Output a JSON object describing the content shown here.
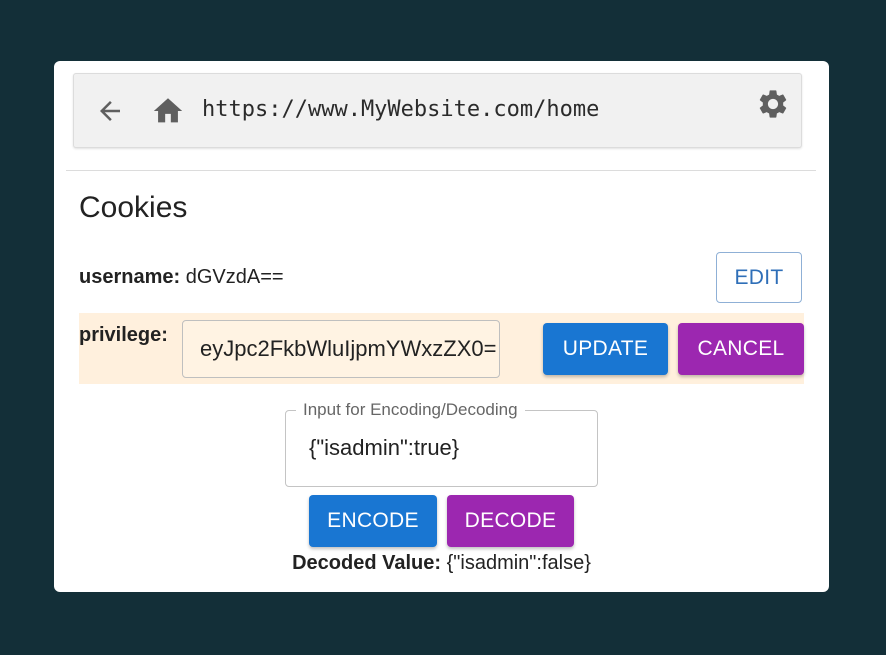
{
  "browser": {
    "url": "https://www.MyWebsite.com/home",
    "icons": [
      "back-arrow-icon",
      "home-icon",
      "gear-icon"
    ]
  },
  "cookies": {
    "title": "Cookies",
    "username_label": "username:",
    "username_value": "dGVzdA==",
    "edit_label": "EDIT",
    "privilege_label": "privilege:",
    "privilege_value": "eyJpc2FkbWluIjpmYWxzZX0=",
    "update_label": "UPDATE",
    "cancel_label": "CANCEL"
  },
  "codec": {
    "field_label": "Input for Encoding/Decoding",
    "field_value": "{\"isadmin\":true}",
    "encode_label": "ENCODE",
    "decode_label": "DECODE",
    "decoded_label": "Decoded Value:",
    "decoded_value": "{\"isadmin\":false}"
  },
  "colors": {
    "background": "#132f38",
    "primary": "#1976d2",
    "secondary": "#9c27b0",
    "highlight_row": "#fff0dd"
  }
}
